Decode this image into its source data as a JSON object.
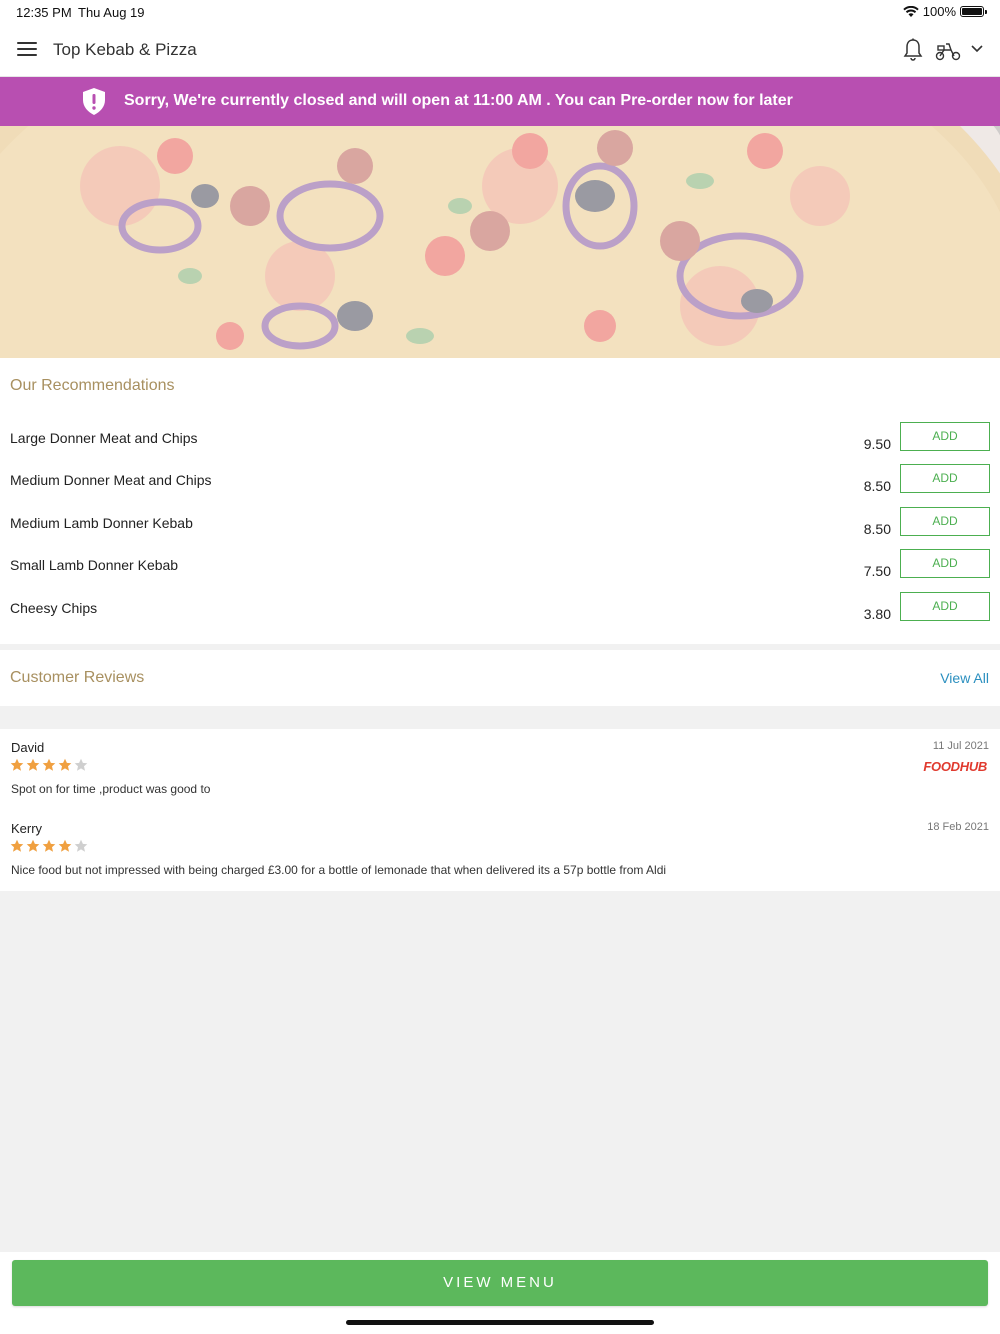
{
  "status_bar": {
    "time": "12:35 PM",
    "date": "Thu Aug 19",
    "battery": "100%"
  },
  "header": {
    "title": "Top Kebab & Pizza"
  },
  "banner": {
    "message": "Sorry, We're currently closed and will open at 11:00 AM . You can Pre-order now for later",
    "color": "#b84fb1"
  },
  "recommendations": {
    "title": "Our Recommendations",
    "items": [
      {
        "name": "Large Donner Meat and Chips",
        "price": "9.50",
        "button": "ADD"
      },
      {
        "name": "Medium Donner Meat and Chips",
        "price": "8.50",
        "button": "ADD"
      },
      {
        "name": "Medium Lamb Donner Kebab",
        "price": "8.50",
        "button": "ADD"
      },
      {
        "name": "Small Lamb Donner Kebab",
        "price": "7.50",
        "button": "ADD"
      },
      {
        "name": "Cheesy Chips",
        "price": "3.80",
        "button": "ADD"
      }
    ]
  },
  "reviews": {
    "title": "Customer Reviews",
    "view_all": "View All",
    "items": [
      {
        "author": "David",
        "date": "11 Jul 2021",
        "rating": 4,
        "max_rating": 5,
        "source": "FOODHUB",
        "text": "Spot on for time ,product was good to"
      },
      {
        "author": "Kerry",
        "date": "18 Feb 2021",
        "rating": 4,
        "max_rating": 5,
        "text": "Nice food but not impressed with being charged £3.00 for a bottle of lemonade that when delivered its a 57p bottle from Aldi"
      }
    ]
  },
  "footer": {
    "view_menu": "VIEW MENU"
  },
  "colors": {
    "accent_green": "#5cb85c",
    "section_title": "#a89060",
    "link_blue": "#2a8fbf",
    "star": "#f0a040"
  }
}
